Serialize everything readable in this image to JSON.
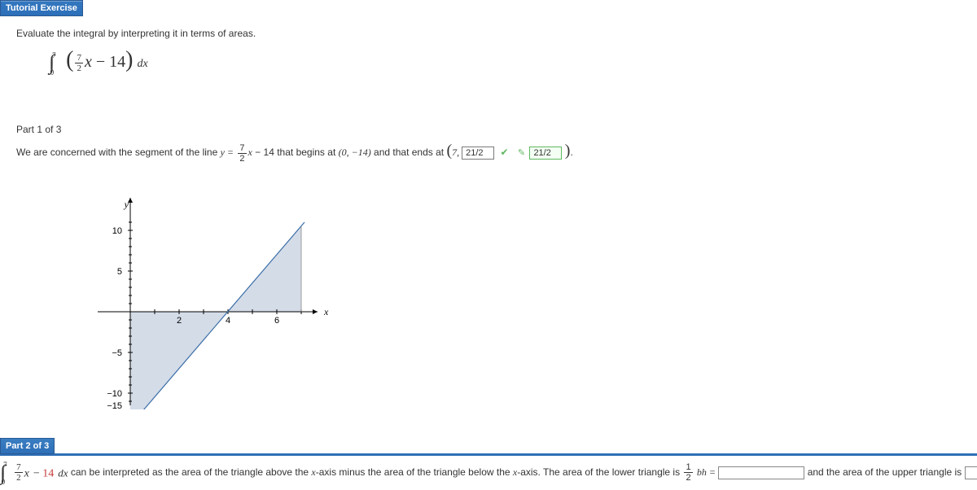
{
  "header": {
    "tutorial": "Tutorial Exercise"
  },
  "prompt": "Evaluate the integral by interpreting it in terms of areas.",
  "integral": {
    "upper": "7",
    "lower": "0",
    "inner_num": "7",
    "inner_den": "2",
    "var": "x",
    "minus": "− 14",
    "dx": "dx"
  },
  "part1": {
    "title": "Part 1 of 3",
    "pre": "We are concerned with the segment of the line ",
    "y_eq": "y =",
    "frac_num": "7",
    "frac_den": "2",
    "xterm": "x",
    "minus14": "− 14",
    "begins": " that begins at ",
    "pt1": "(0, −14)",
    "ends": " and that ends at ",
    "pt2_open": "(7, ",
    "ans1": "21/2",
    "ans2": "21/2",
    "pt2_close": ")."
  },
  "part2": {
    "banner": "Part 2 of 3",
    "int_upper": "7",
    "int_lower": "0",
    "frac_num": "7",
    "frac_den": "2",
    "xterm": "x",
    "minus14": "− 14",
    "dx": "dx",
    "red14": "14",
    "text1": " can be interpreted as the area of the triangle above the ",
    "xaxis": "x",
    "text2": "-axis minus the area of the triangle below the ",
    "text3": "-axis. The area of the lower triangle is ",
    "half_num": "1",
    "half_den": "2",
    "bh": "bh =",
    "blank1": "",
    "text4": " and the area of the upper triangle is ",
    "blank2": ""
  },
  "chart_data": {
    "type": "area",
    "title": "",
    "xlabel": "x",
    "ylabel": "y",
    "xlim": [
      -1,
      7
    ],
    "ylim": [
      -15,
      11
    ],
    "xticks": [
      2,
      4,
      6
    ],
    "yticks": [
      -15,
      -10,
      -5,
      5,
      10
    ],
    "series": [
      {
        "name": "y = 7/2 x − 14",
        "x": [
          0,
          4,
          7
        ],
        "y": [
          -14,
          0,
          10.5
        ]
      }
    ],
    "shaded_regions": [
      {
        "name": "lower triangle",
        "points": [
          [
            0,
            0
          ],
          [
            4,
            0
          ],
          [
            0,
            -14
          ]
        ]
      },
      {
        "name": "upper triangle",
        "points": [
          [
            4,
            0
          ],
          [
            7,
            0
          ],
          [
            7,
            10.5
          ]
        ]
      }
    ]
  }
}
